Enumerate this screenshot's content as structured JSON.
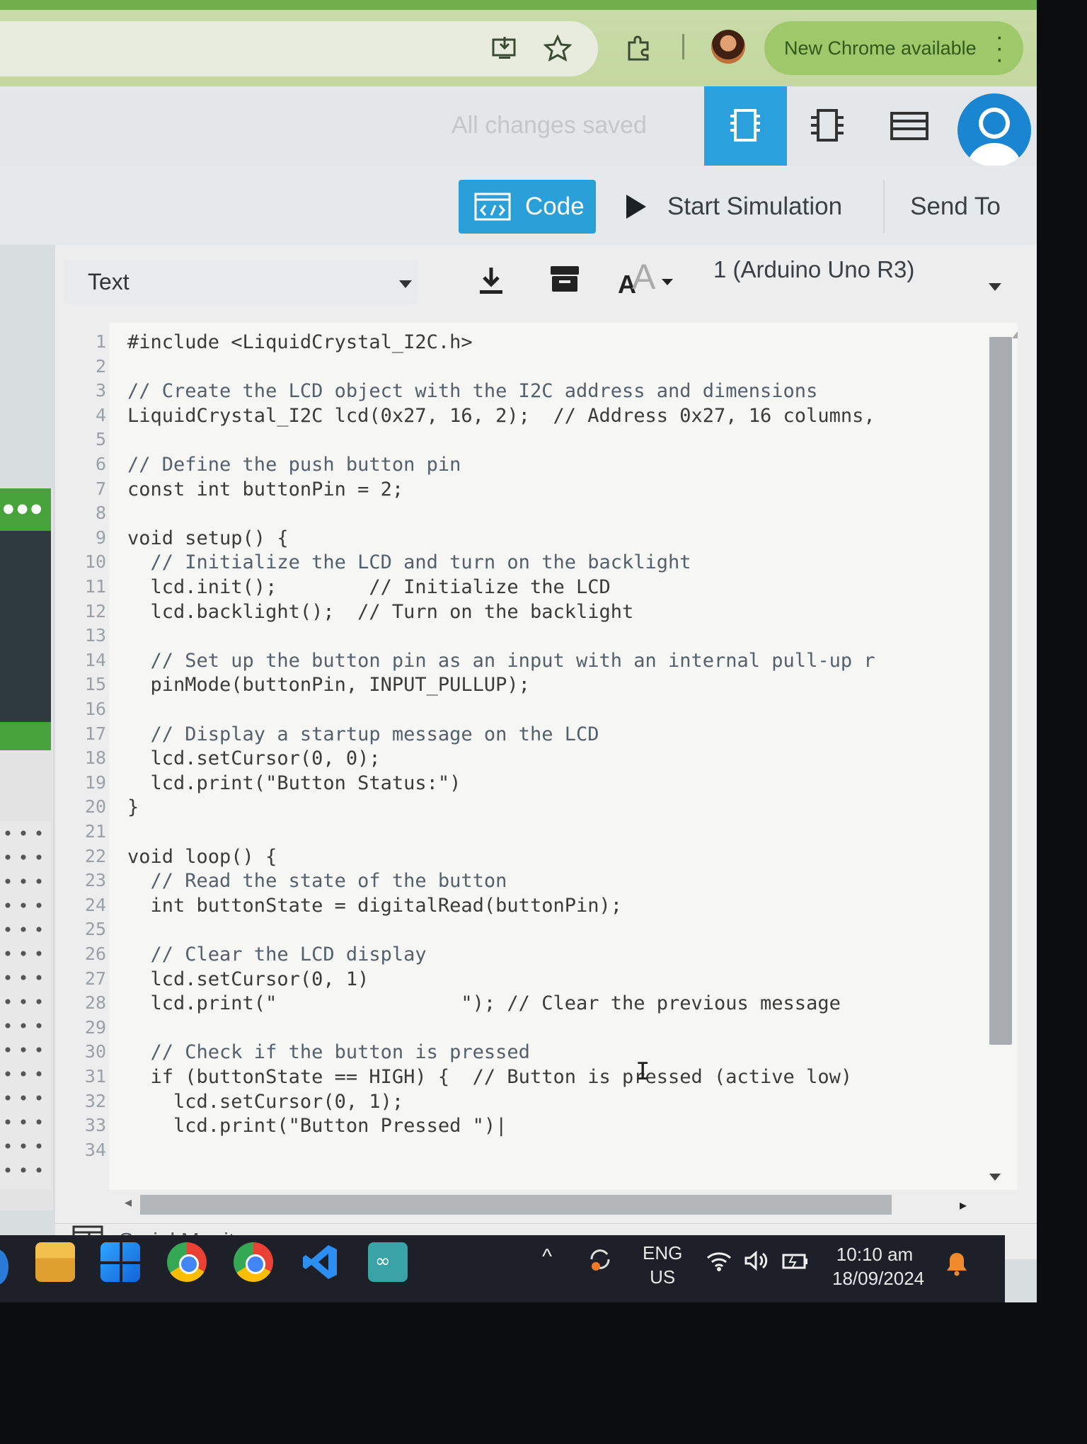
{
  "browser": {
    "update_label": "New Chrome available",
    "icons": [
      "install-app-icon",
      "star-icon",
      "extensions-icon",
      "profile-avatar",
      "menu-dots-icon"
    ]
  },
  "app_bar": {
    "save_status": "All changes saved",
    "views": [
      "circuit-view-icon",
      "schematic-view-icon",
      "component-list-icon"
    ],
    "profile": "user-profile-icon",
    "accent": "#2aa0dc"
  },
  "toolbar": {
    "code_label": "Code",
    "start_label": "Start Simulation",
    "send_label": "Send To"
  },
  "editor_controls": {
    "mode": "Text",
    "board": "1 (Arduino Uno R3)",
    "icons": [
      "download-icon",
      "library-icon",
      "font-size-icon"
    ]
  },
  "code": {
    "lines": [
      {
        "n": "1",
        "t": "#include <LiquidCrystal_I2C.h>"
      },
      {
        "n": "2",
        "t": ""
      },
      {
        "n": "3",
        "t": "// Create the LCD object with the I2C address and dimensions"
      },
      {
        "n": "4",
        "t": "LiquidCrystal_I2C lcd(0x27, 16, 2);  // Address 0x27, 16 columns,"
      },
      {
        "n": "5",
        "t": ""
      },
      {
        "n": "6",
        "t": "// Define the push button pin"
      },
      {
        "n": "7",
        "t": "const int buttonPin = 2;"
      },
      {
        "n": "8",
        "t": ""
      },
      {
        "n": "9",
        "t": "void setup() {"
      },
      {
        "n": "10",
        "t": "  // Initialize the LCD and turn on the backlight"
      },
      {
        "n": "11",
        "t": "  lcd.init();        // Initialize the LCD"
      },
      {
        "n": "12",
        "t": "  lcd.backlight();  // Turn on the backlight"
      },
      {
        "n": "13",
        "t": ""
      },
      {
        "n": "14",
        "t": "  // Set up the button pin as an input with an internal pull-up r"
      },
      {
        "n": "15",
        "t": "  pinMode(buttonPin, INPUT_PULLUP);"
      },
      {
        "n": "16",
        "t": ""
      },
      {
        "n": "17",
        "t": "  // Display a startup message on the LCD"
      },
      {
        "n": "18",
        "t": "  lcd.setCursor(0, 0);"
      },
      {
        "n": "19",
        "t": "  lcd.print(\"Button Status:\")"
      },
      {
        "n": "20",
        "t": "}"
      },
      {
        "n": "21",
        "t": ""
      },
      {
        "n": "22",
        "t": "void loop() {"
      },
      {
        "n": "23",
        "t": "  // Read the state of the button"
      },
      {
        "n": "24",
        "t": "  int buttonState = digitalRead(buttonPin);"
      },
      {
        "n": "25",
        "t": ""
      },
      {
        "n": "26",
        "t": "  // Clear the LCD display"
      },
      {
        "n": "27",
        "t": "  lcd.setCursor(0, 1)"
      },
      {
        "n": "28",
        "t": "  lcd.print(\"                \"); // Clear the previous message"
      },
      {
        "n": "29",
        "t": ""
      },
      {
        "n": "30",
        "t": "  // Check if the button is pressed"
      },
      {
        "n": "31",
        "t": "  if (buttonState == HIGH) {  // Button is pressed (active low)"
      },
      {
        "n": "32",
        "t": "    lcd.setCursor(0, 1);"
      },
      {
        "n": "33",
        "t": "    lcd.print(\"Button Pressed \")|"
      },
      {
        "n": "34",
        "t": ""
      }
    ]
  },
  "serial_monitor": {
    "label": "Serial Monitor"
  },
  "taskbar": {
    "apps": [
      "file-explorer-icon",
      "windows-start-icon",
      "chrome-icon",
      "chrome-alt-icon",
      "vscode-icon",
      "arduino-icon"
    ],
    "lang_top": "ENG",
    "lang_bottom": "US",
    "time": "10:10 am",
    "date": "18/09/2024"
  }
}
